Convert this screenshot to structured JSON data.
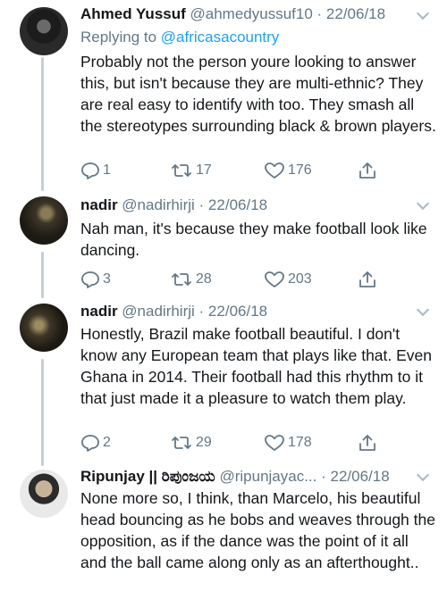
{
  "tweets": [
    {
      "name": "Ahmed Yussuf",
      "handle": "@ahmedyussuf10",
      "date": "· 22/06/18",
      "replying_label": "Replying to ",
      "replying_to": "@africasacountry",
      "text": "Probably not the person youre looking to answer this, but isn't because they are multi-ethnic? They are real easy to identify with too. They smash all the stereotypes surrounding black & brown players.",
      "replies": "1",
      "retweets": "17",
      "likes": "176"
    },
    {
      "name": "nadir",
      "handle": "@nadirhirji",
      "date": "· 22/06/18",
      "text": "Nah man, it's because they make football look like dancing.",
      "replies": "3",
      "retweets": "28",
      "likes": "203"
    },
    {
      "name": "nadir",
      "handle": "@nadirhirji",
      "date": "· 22/06/18",
      "text": "Honestly, Brazil make football beautiful. I don't know any European team that plays like that. Even Ghana in 2014. Their football had this rhythm to it that just made it a pleasure to watch them play.",
      "replies": "2",
      "retweets": "29",
      "likes": "178"
    },
    {
      "name": "Ripunjay || ರಿಪುಂಜಯ",
      "handle": "@ripunjayac...",
      "date": "· 22/06/18",
      "text": "None more so, I think, than Marcelo, his beautiful head bouncing as he bobs and weaves through the opposition, as if the dance was the point of it all and the ball came along only as an afterthought.."
    }
  ],
  "icons": {
    "reply": "reply-icon",
    "retweet": "retweet-icon",
    "like": "heart-icon",
    "share": "share-icon",
    "menu": "chevron-down-icon"
  },
  "colors": {
    "text": "#14171a",
    "secondary": "#657786",
    "link": "#1da1f2",
    "thread_line": "#c4cfd6"
  }
}
